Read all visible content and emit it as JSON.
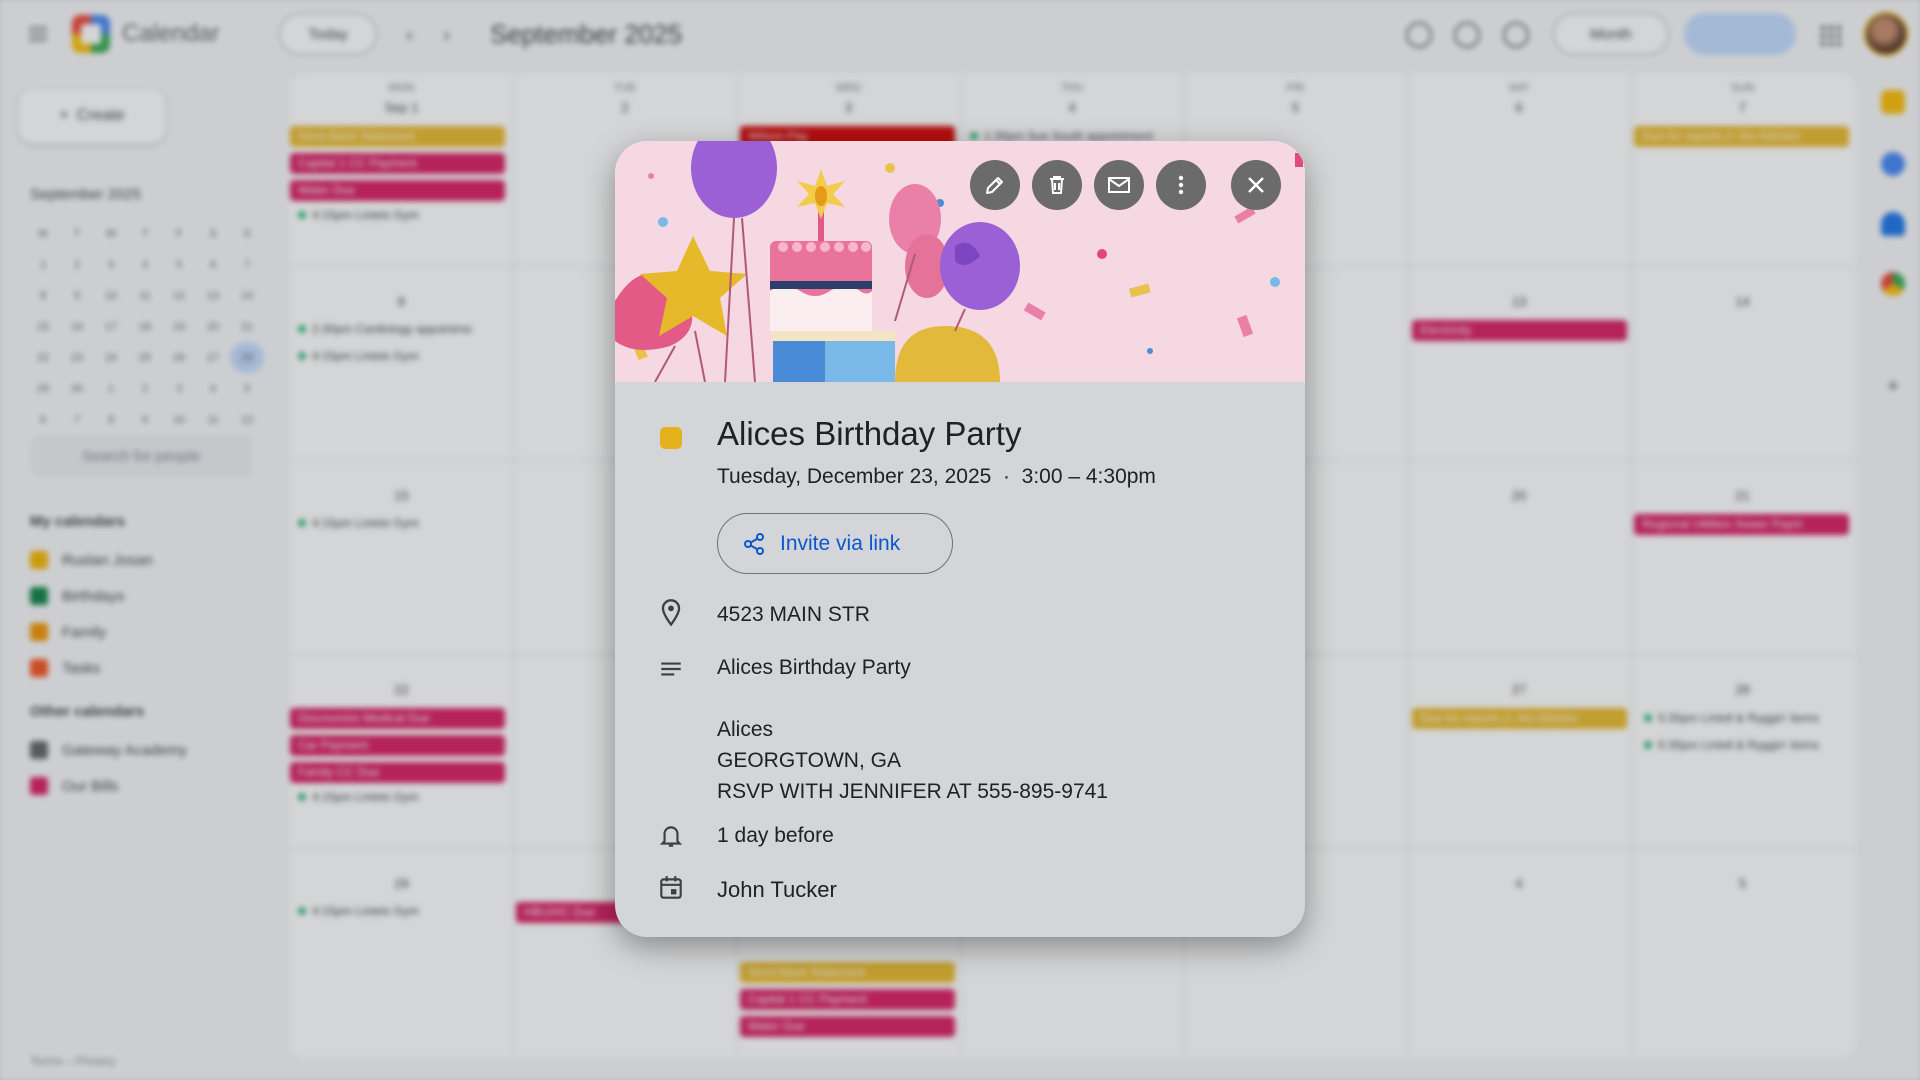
{
  "app": {
    "title": "Calendar"
  },
  "toolbar": {
    "today_label": "Today",
    "month_label": "September 2025",
    "view_label": "Month"
  },
  "sidebar": {
    "create_label": "Create",
    "mini_month": "September 2025",
    "mini_weekdays": [
      "M",
      "T",
      "W",
      "T",
      "F",
      "S",
      "S"
    ],
    "mini_days": [
      "1",
      "2",
      "3",
      "4",
      "5",
      "6",
      "7",
      "8",
      "9",
      "10",
      "11",
      "12",
      "13",
      "14",
      "15",
      "16",
      "17",
      "18",
      "19",
      "20",
      "21",
      "22",
      "23",
      "24",
      "25",
      "26",
      "27",
      "28",
      "29",
      "30",
      "1",
      "2",
      "3",
      "4",
      "5",
      "6",
      "7",
      "8",
      "9",
      "10",
      "11",
      "12"
    ],
    "search_people": "Search for people",
    "my_calendars_title": "My calendars",
    "my_calendars": [
      {
        "label": "Ruslan Josan",
        "color": "#f4b400"
      },
      {
        "label": "Birthdays",
        "color": "#0b8043"
      },
      {
        "label": "Family",
        "color": "#f09300"
      },
      {
        "label": "Tasks",
        "color": "#f4511e"
      }
    ],
    "other_calendars_title": "Other calendars",
    "other_calendars": [
      {
        "label": "Gateway Academy",
        "color": "#616161"
      },
      {
        "label": "Our Bills",
        "color": "#d81b60"
      }
    ],
    "footer": "Terms – Privacy"
  },
  "grid": {
    "weekdays": [
      "MON",
      "TUE",
      "WED",
      "THU",
      "FRI",
      "SAT",
      "SUN"
    ],
    "week1_days": [
      "Sep 1",
      "2",
      "3",
      "4",
      "5",
      "6",
      "7"
    ],
    "week_start_nums": [
      "8",
      "15",
      "22",
      "29"
    ],
    "other_nums": [
      "13",
      "14",
      "20",
      "21",
      "27",
      "28",
      "4",
      "5"
    ],
    "events": {
      "bank_statement": "Send Bank Statement",
      "capital_one": "Capital 1 CC Payment",
      "water_due": "Water Due",
      "lintels": "4:15pm Lintels Gym",
      "cardiology": "2:30pm Cardiology appointme",
      "electricity": "Electricity",
      "regional_utilities": "Regional Utilities Sewer Paym",
      "discoveries": "Discoveries Medical Due",
      "car_payment": "Car Payment",
      "family_cc": "Family CC Due",
      "due_day_reports": "Due for reports (+ Am Kitchen",
      "lintels_bmw": "5:30pm Lintell & Ryggin' items",
      "hbuhc": "HBU/HC Due",
      "pay_day": "Wilson Pay",
      "sue_south": "1:30pm Sue South appointment"
    }
  },
  "popup": {
    "title": "Alices Birthday Party",
    "when": "Tuesday, December 23, 2025  ·  3:00 – 4:30pm",
    "invite_label": "Invite via link",
    "location": "4523 MAIN STR",
    "description_lines": [
      "Alices Birthday Party",
      "",
      "Alices",
      "GEORGTOWN, GA",
      "RSVP WITH JENNIFER AT 555-895-9741"
    ],
    "reminder": "1 day before",
    "organizer": "John Tucker",
    "event_color": "#e5b21e",
    "icons": {
      "edit": "pencil-icon",
      "delete": "trash-icon",
      "email": "mail-icon",
      "more": "more-vert-icon",
      "close": "close-icon",
      "location": "location-pin-icon",
      "description": "notes-icon",
      "reminder": "bell-icon",
      "calendar": "calendar-icon",
      "invite": "share-icon"
    }
  }
}
